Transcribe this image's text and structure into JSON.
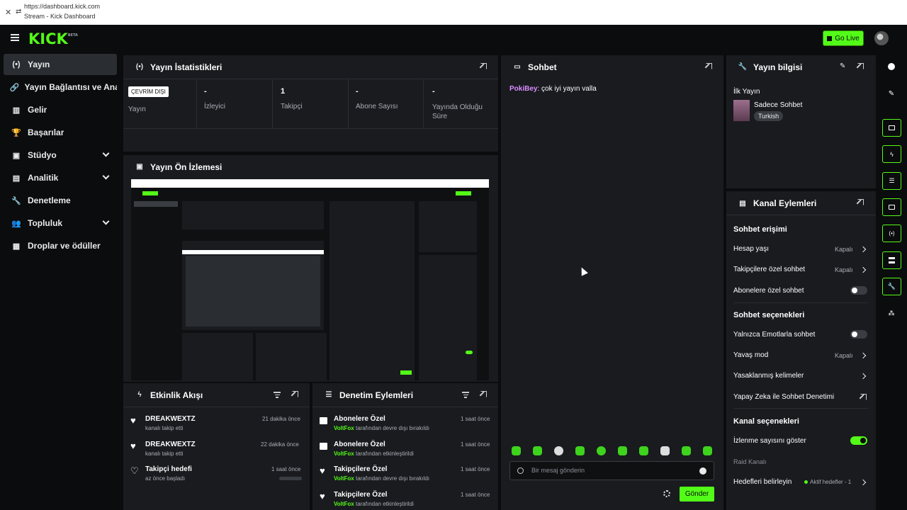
{
  "browser": {
    "url": "https://dashboard.kick.com",
    "title": "Stream - Kick Dashboard"
  },
  "header": {
    "logo": "KICK",
    "logo_sup": "BETA",
    "go_live": "Go Live"
  },
  "sidebar": {
    "items": [
      {
        "icon": "(•)",
        "label": "Yayın"
      },
      {
        "icon": "🔗",
        "label": "Yayın Bağlantısı ve Anahtarı"
      },
      {
        "icon": "▥",
        "label": "Gelir"
      },
      {
        "icon": "🏆",
        "label": "Başarılar"
      },
      {
        "icon": "▣",
        "label": "Stüdyo"
      },
      {
        "icon": "▤",
        "label": "Analitik"
      },
      {
        "icon": "🔧",
        "label": "Denetleme"
      },
      {
        "icon": "👥",
        "label": "Topluluk"
      },
      {
        "icon": "▦",
        "label": "Droplar ve ödüller"
      }
    ]
  },
  "stats": {
    "title": "Yayın İstatistikleri",
    "status_badge": "ÇEVRİM DIŞI",
    "items": [
      {
        "value": "",
        "label": "Yayın"
      },
      {
        "value": "-",
        "label": "İzleyici"
      },
      {
        "value": "1",
        "label": "Takipçi"
      },
      {
        "value": "-",
        "label": "Abone Sayısı"
      },
      {
        "value": "-",
        "label": "Yayında Olduğu Süre"
      }
    ]
  },
  "preview": {
    "title": "Yayın Ön İzlemesi"
  },
  "activity": {
    "title": "Etkinlik Akışı",
    "items": [
      {
        "title": "DREAKWEXTZ",
        "sub": "kanalı takip etti",
        "time": "21 dakika önce"
      },
      {
        "title": "DREAKWEXTZ",
        "sub": "kanalı takip etti",
        "time": "22 dakika önce"
      },
      {
        "title": "Takipçi hedefi",
        "sub": "az önce başladı",
        "time": "1 saat önce"
      }
    ]
  },
  "moderation": {
    "title": "Denetim Eylemleri",
    "items": [
      {
        "title": "Abonelere Özel",
        "user": "VoltFox",
        "sub": " tarafından devre dışı bırakıldı",
        "time": "1 saat önce"
      },
      {
        "title": "Abonelere Özel",
        "user": "VoltFox",
        "sub": " tarafından etkinleştirildi",
        "time": "1 saat önce"
      },
      {
        "title": "Takipçilere Özel",
        "user": "VoltFox",
        "sub": " tarafından devre dışı bırakıldı",
        "time": "1 saat önce"
      },
      {
        "title": "Takipçilere Özel",
        "user": "VoltFox",
        "sub": " tarafından etkinleştirildi",
        "time": "1 saat önce"
      }
    ]
  },
  "chat": {
    "title": "Sohbet",
    "message_user": "PokiBey",
    "message_text": ": çok iyi yayın valla",
    "placeholder": "Bir mesaj gönderin",
    "send": "Gönder"
  },
  "stream_info": {
    "title": "Yayın bilgisi",
    "stream_title": "İlk Yayın",
    "category": "Sadece Sohbet",
    "tag": "Turkish"
  },
  "channel_actions": {
    "title": "Kanal Eylemleri",
    "chat_access": "Sohbet erişimi",
    "account_age": "Hesap yaşı",
    "account_age_val": "Kapalı",
    "followers_only": "Takipçilere özel sohbet",
    "followers_only_val": "Kapalı",
    "subs_only": "Abonelere özel sohbet",
    "chat_options": "Sohbet seçenekleri",
    "emotes_only": "Yalnızca Emotlarla sohbet",
    "slow_mode": "Yavaş mod",
    "slow_mode_val": "Kapalı",
    "banned_words": "Yasaklanmış kelimeler",
    "ai_moderation": "Yapay Zeka ile Sohbet Denetimi",
    "channel_options": "Kanal seçenekleri",
    "show_viewers": "İzlenme sayısını göster",
    "raid": "Raid Kanalı",
    "set_goals": "Hedefleri belirleyin",
    "goals_val": "Aktif hedefler - 1"
  },
  "colors": {
    "accent": "#53fc18",
    "panel": "#191b1f",
    "bg": "#0b0c0d",
    "chat_user": "#d98cff"
  }
}
